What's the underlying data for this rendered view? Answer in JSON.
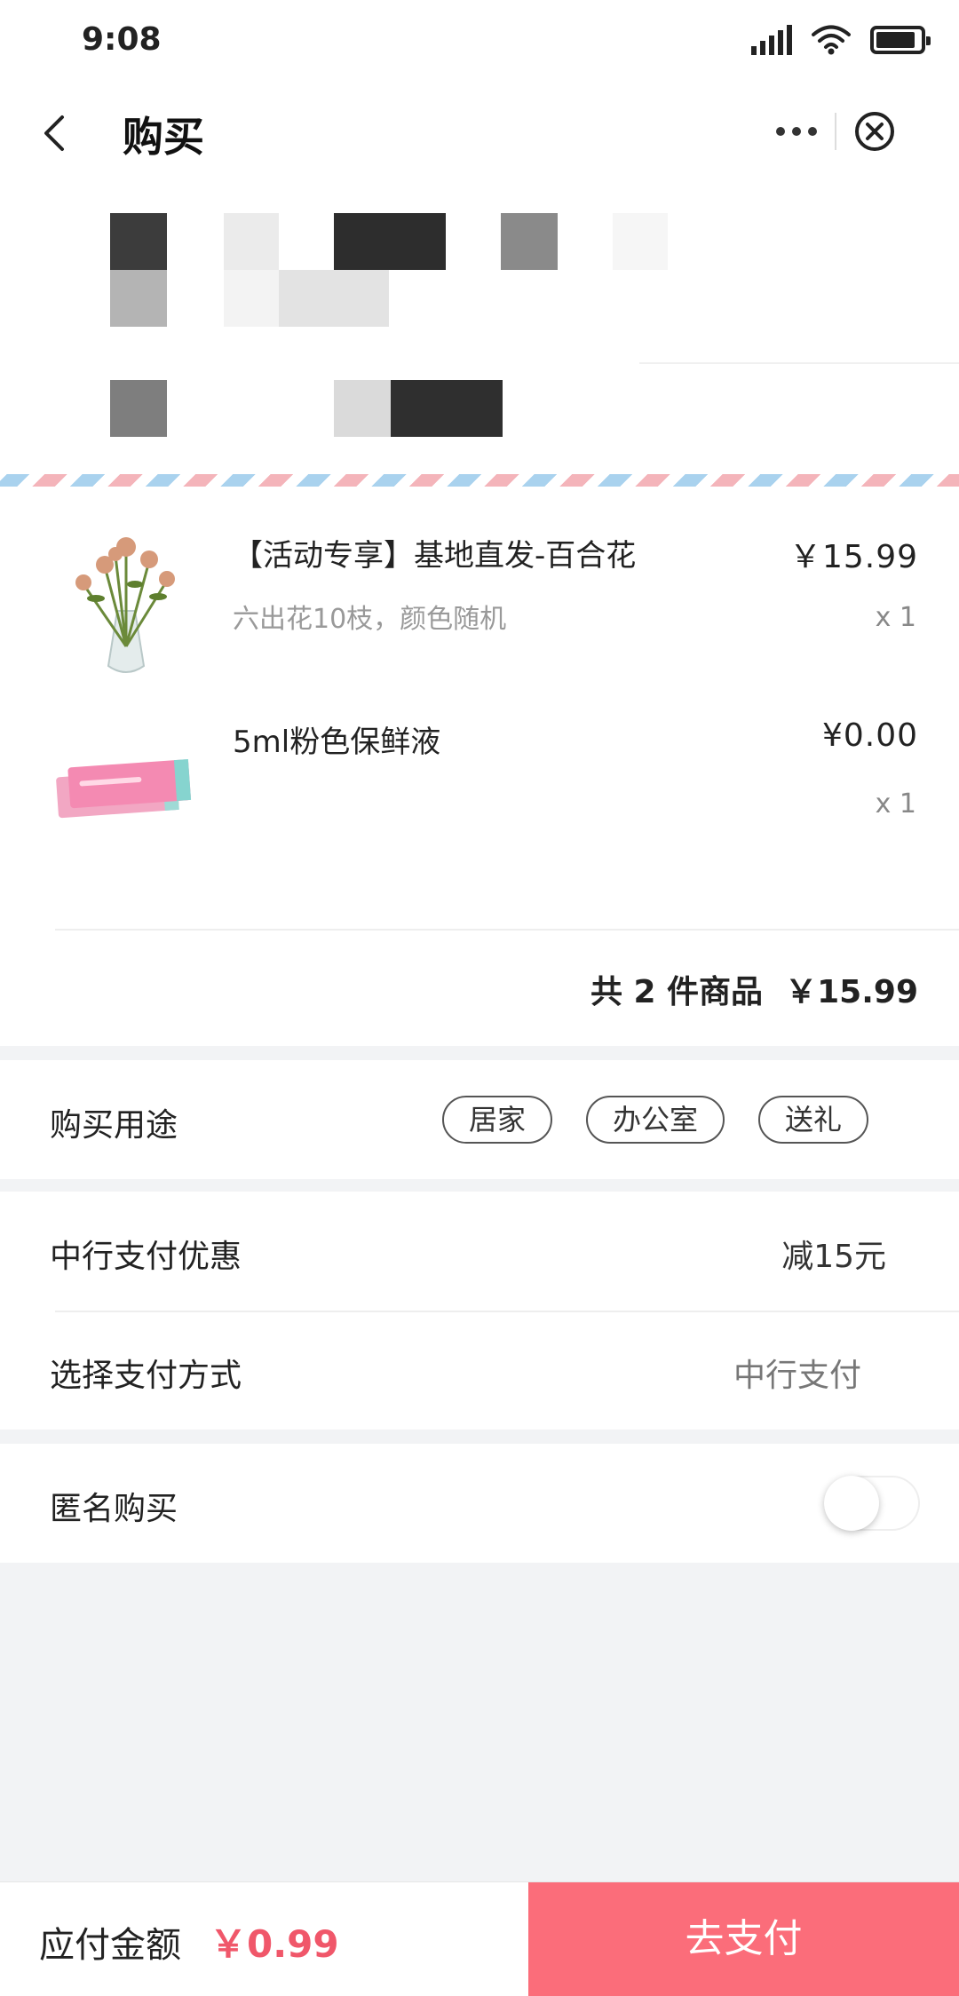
{
  "status_bar": {
    "time": "9:08"
  },
  "nav": {
    "title": "购买"
  },
  "order": {
    "items": [
      {
        "name": "【活动专享】基地直发-百合花",
        "spec": "六出花10枝，颜色随机",
        "price": "￥15.99",
        "qty": "x 1"
      },
      {
        "name": "5ml粉色保鲜液",
        "spec": "",
        "price": "¥0.00",
        "qty": "x 1"
      }
    ],
    "summary": "共 2 件商品  ￥15.99"
  },
  "purpose": {
    "label": "购买用途",
    "tags": [
      "居家",
      "办公室",
      "送礼"
    ]
  },
  "payment": {
    "discount_label": "中行支付优惠",
    "discount_value": "减15元",
    "method_label": "选择支付方式",
    "method_value": "中行支付"
  },
  "anonymous": {
    "label": "匿名购买",
    "enabled": false
  },
  "footer": {
    "pay_label": "应付金额",
    "pay_amount": "￥0.99",
    "pay_button": "去支付"
  },
  "colors": {
    "accent": "#fb6d7a",
    "price_red": "#f0576a"
  }
}
